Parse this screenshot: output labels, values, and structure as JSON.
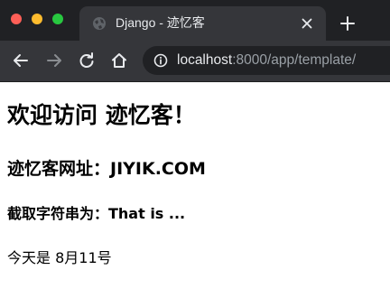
{
  "window": {
    "controls": [
      "close",
      "minimize",
      "maximize"
    ],
    "colors": {
      "close": "#fe5f57",
      "minimize": "#febc2e",
      "maximize": "#28c840"
    }
  },
  "tab": {
    "title": "Django - 迹忆客",
    "favicon": "globe-icon",
    "close": "close-icon"
  },
  "toolbar": {
    "icons": [
      "back-arrow-icon",
      "forward-arrow-icon",
      "reload-icon",
      "home-icon"
    ],
    "address": {
      "host": "localhost",
      "rest": ":8000/app/template/",
      "icon": "info-icon"
    }
  },
  "page": {
    "h1": "欢迎访问 迹忆客！",
    "h2": "迹忆客网址：JIYIK.COM",
    "h3": "截取字符串为：That is ...",
    "p": "今天是 8月11号"
  }
}
